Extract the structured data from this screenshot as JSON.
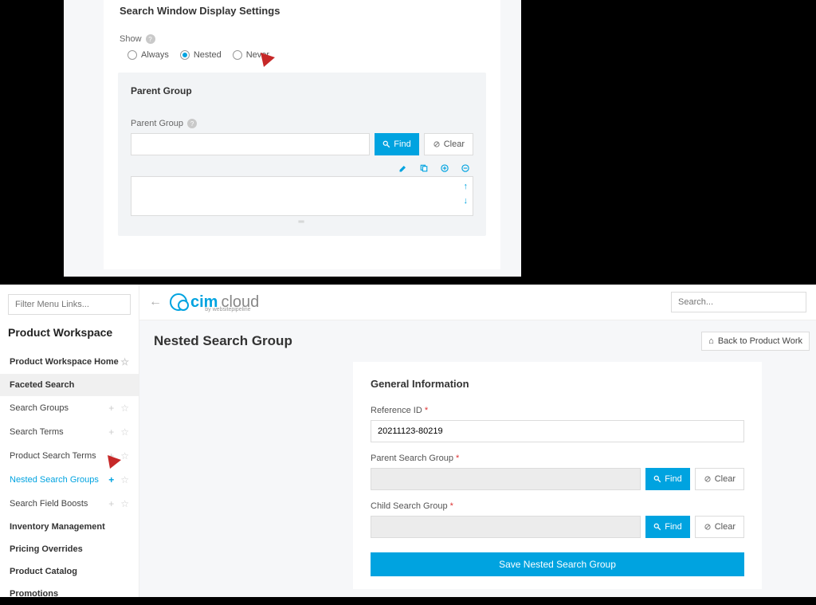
{
  "upper": {
    "section_title": "Search Window Display Settings",
    "show_label": "Show",
    "radios": {
      "always": "Always",
      "nested": "Nested",
      "never": "Never",
      "selected": "nested"
    },
    "parent_panel_title": "Parent Group",
    "parent_group_label": "Parent Group",
    "find_label": "Find",
    "clear_label": "Clear"
  },
  "sidebar": {
    "filter_placeholder": "Filter Menu Links...",
    "workspace_title": "Product Workspace",
    "items": [
      {
        "label": "Product Workspace Home",
        "bold": true,
        "has_star": true
      },
      {
        "label": "Faceted Search",
        "active_section": true
      },
      {
        "label": "Search Groups",
        "sub": true,
        "has_plus": true,
        "has_star": true
      },
      {
        "label": "Search Terms",
        "sub": true,
        "has_plus": true,
        "has_star": true
      },
      {
        "label": "Product Search Terms",
        "sub": true,
        "has_plus": true,
        "has_star": true
      },
      {
        "label": "Nested Search Groups",
        "sub": true,
        "selected": true,
        "has_plus_blue": true,
        "has_star": true
      },
      {
        "label": "Search Field Boosts",
        "sub": true,
        "has_plus": true,
        "has_star": true
      },
      {
        "label": "Inventory Management",
        "bold": true
      },
      {
        "label": "Pricing Overrides",
        "bold": true
      },
      {
        "label": "Product Catalog",
        "bold": true
      },
      {
        "label": "Promotions",
        "bold": true
      }
    ]
  },
  "topbar": {
    "logo_text_1": "cim",
    "logo_text_2": "cloud",
    "logo_tagline": "by websitepipeline",
    "search_placeholder": "Search..."
  },
  "main": {
    "page_title": "Nested Search Group",
    "back_button": "Back to Product Work",
    "form_title": "General Information",
    "reference_id_label": "Reference ID",
    "reference_id_value": "20211123-80219",
    "parent_search_group_label": "Parent Search Group",
    "child_search_group_label": "Child Search Group",
    "find_label": "Find",
    "clear_label": "Clear",
    "save_label": "Save Nested Search Group"
  }
}
